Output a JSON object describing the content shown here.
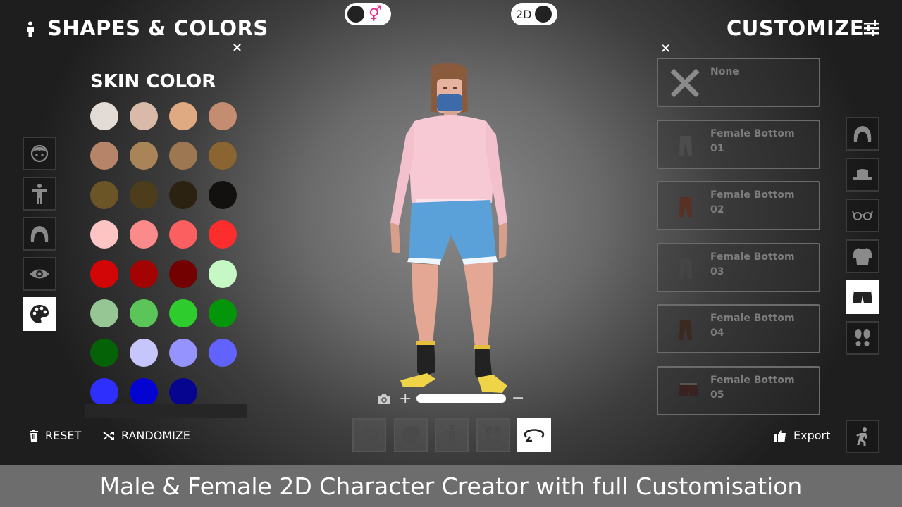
{
  "left_panel": {
    "title": "SHAPES & COLORS",
    "close": "×",
    "section_title": "SKIN COLOR",
    "categories": [
      {
        "icon": "face-icon",
        "active": false
      },
      {
        "icon": "body-icon",
        "active": false
      },
      {
        "icon": "hair-icon",
        "active": false
      },
      {
        "icon": "eye-icon",
        "active": false
      },
      {
        "icon": "palette-icon",
        "active": true
      }
    ],
    "swatches": [
      "#e3dbd5",
      "#d9b9a8",
      "#dfa981",
      "#c48d72",
      "#b58469",
      "#a98459",
      "#9c7752",
      "#8a6532",
      "#6b5527",
      "#4d3d1b",
      "#2c2212",
      "#121110",
      "#fcc5c4",
      "#fb8b8b",
      "#fb5f5f",
      "#fb2d2d",
      "#d20606",
      "#a40304",
      "#730101",
      "#c6f8c6",
      "#95c694",
      "#5cc55a",
      "#2fcc2e",
      "#05950a",
      "#066207",
      "#c7c6fc",
      "#9593fd",
      "#6262fe",
      "#2f2ffd",
      "#0404d2",
      "#05058f"
    ]
  },
  "top_toggles": {
    "gender": {
      "icon": "gender-symbol-icon",
      "glyph": "⚥"
    },
    "mode": {
      "label": "2D"
    }
  },
  "right_panel": {
    "title": "CUSTOMIZE",
    "close": "×",
    "items": [
      {
        "label": "None",
        "icon": "none-x-icon"
      },
      {
        "label": "Female Bottom\n01",
        "icon": "pants-icon"
      },
      {
        "label": "Female Bottom\n02",
        "icon": "pants-icon"
      },
      {
        "label": "Female Bottom\n03",
        "icon": "pants-icon"
      },
      {
        "label": "Female Bottom\n04",
        "icon": "pants-icon"
      },
      {
        "label": "Female Bottom\n05",
        "icon": "shorts-icon"
      }
    ],
    "side_categories": [
      {
        "icon": "hair-icon",
        "active": false
      },
      {
        "icon": "hat-icon",
        "active": false
      },
      {
        "icon": "glasses-icon",
        "active": false
      },
      {
        "icon": "shirt-icon",
        "active": false
      },
      {
        "icon": "shorts-icon",
        "active": true
      },
      {
        "icon": "feet-icon",
        "active": false
      }
    ]
  },
  "bottom": {
    "reset_label": "RESET",
    "randomize_label": "RANDOMIZE",
    "export_label": "Export",
    "zoom_plus": "+",
    "zoom_minus": "−",
    "tabs": [
      {
        "icon": "face-icon",
        "active": false
      },
      {
        "icon": "shirt-icon",
        "active": false
      },
      {
        "icon": "body-icon",
        "active": false
      },
      {
        "icon": "feet-icon",
        "active": false
      },
      {
        "icon": "rotate-icon",
        "active": true
      }
    ]
  },
  "banner": "Male & Female 2D Character Creator with full Customisation"
}
